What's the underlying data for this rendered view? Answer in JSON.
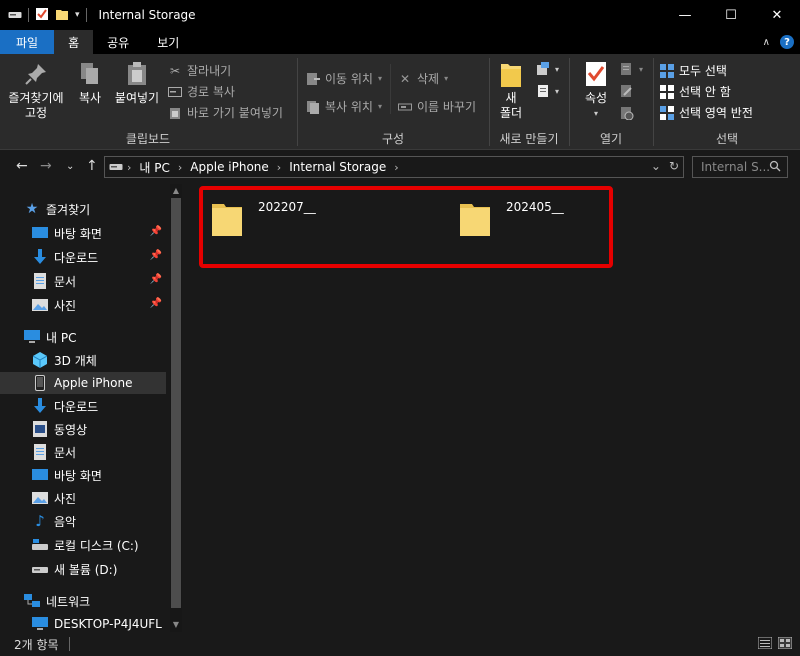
{
  "window": {
    "title": "Internal Storage",
    "minimize": "—",
    "maximize": "☐",
    "close": "✕"
  },
  "tabs": {
    "file": "파일",
    "home": "홈",
    "share": "공유",
    "view": "보기"
  },
  "ribbon": {
    "clipboard": {
      "label": "클립보드",
      "pin_line1": "즐겨찾기에",
      "pin_line2": "고정",
      "copy": "복사",
      "paste": "붙여넣기",
      "cut": "잘라내기",
      "copy_path": "경로 복사",
      "paste_shortcut": "바로 가기 붙여넣기"
    },
    "organize": {
      "label": "구성",
      "move_to": "이동 위치",
      "copy_to": "복사 위치",
      "delete": "삭제",
      "rename": "이름 바꾸기"
    },
    "new": {
      "label": "새로 만들기",
      "new_folder_line1": "새",
      "new_folder_line2": "폴더"
    },
    "open": {
      "label": "열기",
      "properties": "속성"
    },
    "select": {
      "label": "선택",
      "select_all": "모두 선택",
      "select_none": "선택 안 함",
      "invert": "선택 영역 반전"
    }
  },
  "address": {
    "crumbs": [
      "내 PC",
      "Apple iPhone",
      "Internal Storage"
    ],
    "search_placeholder": "Internal S..."
  },
  "sidebar": {
    "quick_access": "즐겨찾기",
    "quick_items": [
      "바탕 화면",
      "다운로드",
      "문서",
      "사진"
    ],
    "this_pc": "내 PC",
    "pc_items": [
      "3D 개체",
      "Apple iPhone",
      "다운로드",
      "동영상",
      "문서",
      "바탕 화면",
      "사진",
      "음악",
      "로컬 디스크 (C:)",
      "새 볼륨 (D:)"
    ],
    "network": "네트워크",
    "network_items": [
      "DESKTOP-P4J4UFL"
    ]
  },
  "content": {
    "folders": [
      "202207__",
      "202405__"
    ]
  },
  "status": {
    "count": "2개 항목"
  },
  "colors": {
    "highlight": "#e60000",
    "accent": "#1a6fc4",
    "folder": "#f7d774"
  }
}
